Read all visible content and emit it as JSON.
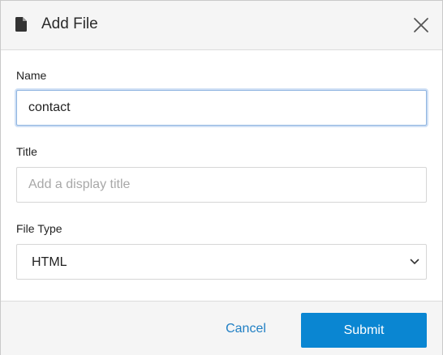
{
  "dialog": {
    "title": "Add File",
    "header_icon": "file-icon",
    "close_icon": "close-icon"
  },
  "form": {
    "name": {
      "label": "Name",
      "value": "contact"
    },
    "title": {
      "label": "Title",
      "placeholder": "Add a display title",
      "value": ""
    },
    "file_type": {
      "label": "File Type",
      "selected": "HTML",
      "icon": "chevron-down-icon"
    }
  },
  "footer": {
    "cancel_label": "Cancel",
    "submit_label": "Submit"
  },
  "colors": {
    "accent": "#0a86d2",
    "link": "#1f7fc4",
    "focus_ring": "#cfe0f5"
  }
}
